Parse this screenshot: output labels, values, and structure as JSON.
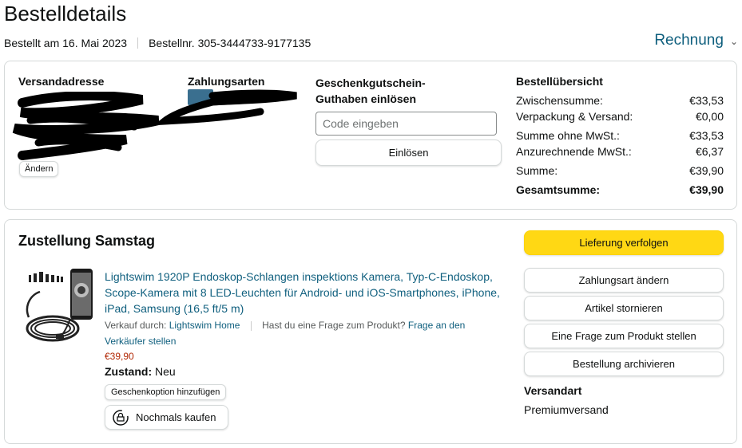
{
  "page": {
    "title": "Bestelldetails",
    "ordered_date": "Bestellt am 16. Mai 2023",
    "order_number": "Bestellnr. 305-3444733-9177135",
    "invoice_label": "Rechnung"
  },
  "summary_box": {
    "address_heading": "Versandadresse",
    "change_label": "Ändern",
    "payment_heading": "Zahlungsarten",
    "giftcard_heading": "Geschenkgutschein-Guthaben einlösen",
    "giftcard_placeholder": "Code eingeben",
    "redeem_label": "Einlösen",
    "order_summary_heading": "Bestellübersicht",
    "rows": [
      {
        "label": "Zwischensumme:",
        "value": "€33,53"
      },
      {
        "label": "Verpackung & Versand:",
        "value": "€0,00"
      },
      {
        "label": "Summe ohne MwSt.:",
        "value": "€33,53"
      },
      {
        "label": "Anzurechnende MwSt.:",
        "value": "€6,37"
      },
      {
        "label": "Summe:",
        "value": "€39,90"
      },
      {
        "label": "Gesamtsumme:",
        "value": "€39,90"
      }
    ]
  },
  "shipment": {
    "heading": "Zustellung Samstag",
    "product_title": "Lightswim 1920P Endoskop-Schlangen inspektions Kamera, Typ-C-Endoskop, Scope-Kamera mit 8 LED-Leuchten für Android- und iOS-Smartphones, iPhone, iPad, Samsung (16,5 ft/5 m)",
    "sold_by_label": "Verkauf durch:",
    "seller": "Lightswim Home",
    "question_label": "Hast du eine Frage zum Produkt?",
    "question_link": "Frage an den Verkäufer stellen",
    "price": "€39,90",
    "condition_label": "Zustand:",
    "condition_value": "Neu",
    "gift_option_label": "Geschenkoption hinzufügen",
    "buy_again_label": "Nochmals kaufen",
    "actions": {
      "track": "Lieferung verfolgen",
      "change_payment": "Zahlungsart ändern",
      "cancel": "Artikel stornieren",
      "ask": "Eine Frage zum Produkt stellen",
      "archive": "Bestellung archivieren"
    },
    "shipping_type_heading": "Versandart",
    "shipping_type": "Premiumversand"
  },
  "colors": {
    "link": "#0f5f7e",
    "primary_button": "#ffd814",
    "price": "#b12704"
  }
}
